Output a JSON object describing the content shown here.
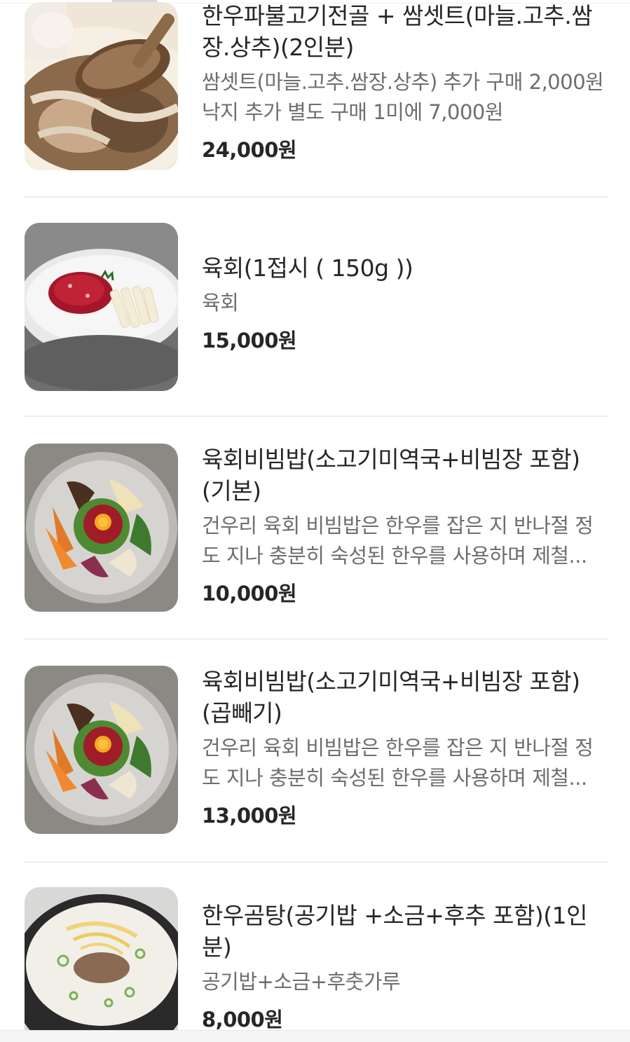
{
  "menu": {
    "items": [
      {
        "name": "한우파불고기전골 + 쌈셋트(마늘.고추.쌈장.상추)(2인분)",
        "description": "쌈셋트(마늘.고추.쌈장.상추) 추가 구매 2,000원 낙지 추가 별도 구매 1미에 7,000원",
        "price": "24,000원",
        "image": "bulgogi-hotpot-photo"
      },
      {
        "name": "육회(1접시 ( 150g ))",
        "description": "육회",
        "price": "15,000원",
        "image": "yukhoe-plate-photo"
      },
      {
        "name": "육회비빔밥(소고기미역국+비빔장 포함)(기본)",
        "description": "건우리 육회 비빔밥은 한우를 잡은 지 반나절 정도 지나 충분히 숙성된 한우를 사용하며 제철...",
        "price": "10,000원",
        "image": "yukhoe-bibimbap-photo"
      },
      {
        "name": "육회비빔밥(소고기미역국+비빔장 포함)(곱빼기)",
        "description": "건우리 육회 비빔밥은 한우를 잡은 지 반나절 정도 지나 충분히 숙성된 한우를 사용하며 제철...",
        "price": "13,000원",
        "image": "yukhoe-bibimbap-photo"
      },
      {
        "name": "한우곰탕(공기밥 +소금+후추 포함)(1인분)",
        "description": "공기밥+소금+후춧가루",
        "price": "8,000원",
        "image": "beef-bone-soup-photo"
      }
    ]
  },
  "colors": {
    "text": "#262626",
    "description": "#6e6e6e",
    "divider": "#eeeeee"
  }
}
